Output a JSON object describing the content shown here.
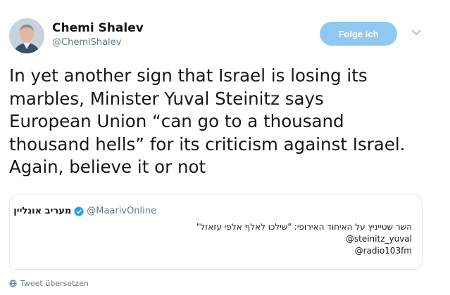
{
  "author": {
    "name": "Chemi Shalev",
    "handle": "@ChemiShalev"
  },
  "follow_button": {
    "label": "Folge ich"
  },
  "tweet": {
    "lines": [
      "In yet another sign that Israel is losing its",
      "marbles, Minister Yuval Steinitz says",
      "European Union “can go to a thousand",
      "thousand hells” for its criticism against Israel.",
      "Again, believe it or not"
    ]
  },
  "quoted": {
    "name": "מעריב אונליין",
    "handle": "@MaarivOnline",
    "lines": [
      "השר שטייניץ על האיחוד האירופי: \"שילכו לאלף אלפי עזאזל\"",
      "@steinitz_yuval",
      "@radio103fm"
    ]
  },
  "translate": {
    "label": "Tweet übersetzen"
  },
  "colors": {
    "follow_bg": "#8fc9f1",
    "verified": "#1da1f2",
    "muted": "#657786"
  },
  "icons": [
    "avatar",
    "chevron-down-icon",
    "verified-badge-icon",
    "globe-icon"
  ]
}
